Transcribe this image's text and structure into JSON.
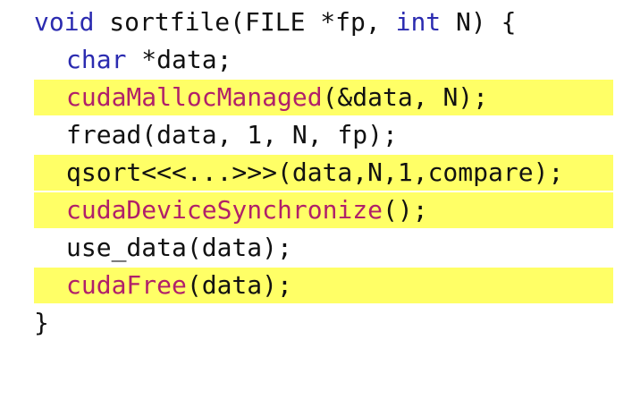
{
  "colors": {
    "keyword": "#2b2bb0",
    "cuda_function": "#b0206a",
    "highlight": "#ffff66",
    "plain": "#111111"
  },
  "code": {
    "line1": {
      "kw1": "void",
      "t1": " sortfile(FILE *fp, ",
      "kw2": "int",
      "t2": " N) {"
    },
    "line2": {
      "kw": "char",
      "t": " *data;"
    },
    "line3": {
      "fn": "cudaMallocManaged",
      "t": "(&data, N);"
    },
    "line4": {
      "t": "fread(data, 1, N, fp);"
    },
    "line5": {
      "t": "qsort<<<...>>>(data,N,1,compare);"
    },
    "line6": {
      "fn": "cudaDeviceSynchronize",
      "t": "();"
    },
    "line7": {
      "t": "use_data(data);"
    },
    "line8": {
      "fn": "cudaFree",
      "t": "(data);"
    },
    "line9": {
      "t": "}"
    }
  }
}
